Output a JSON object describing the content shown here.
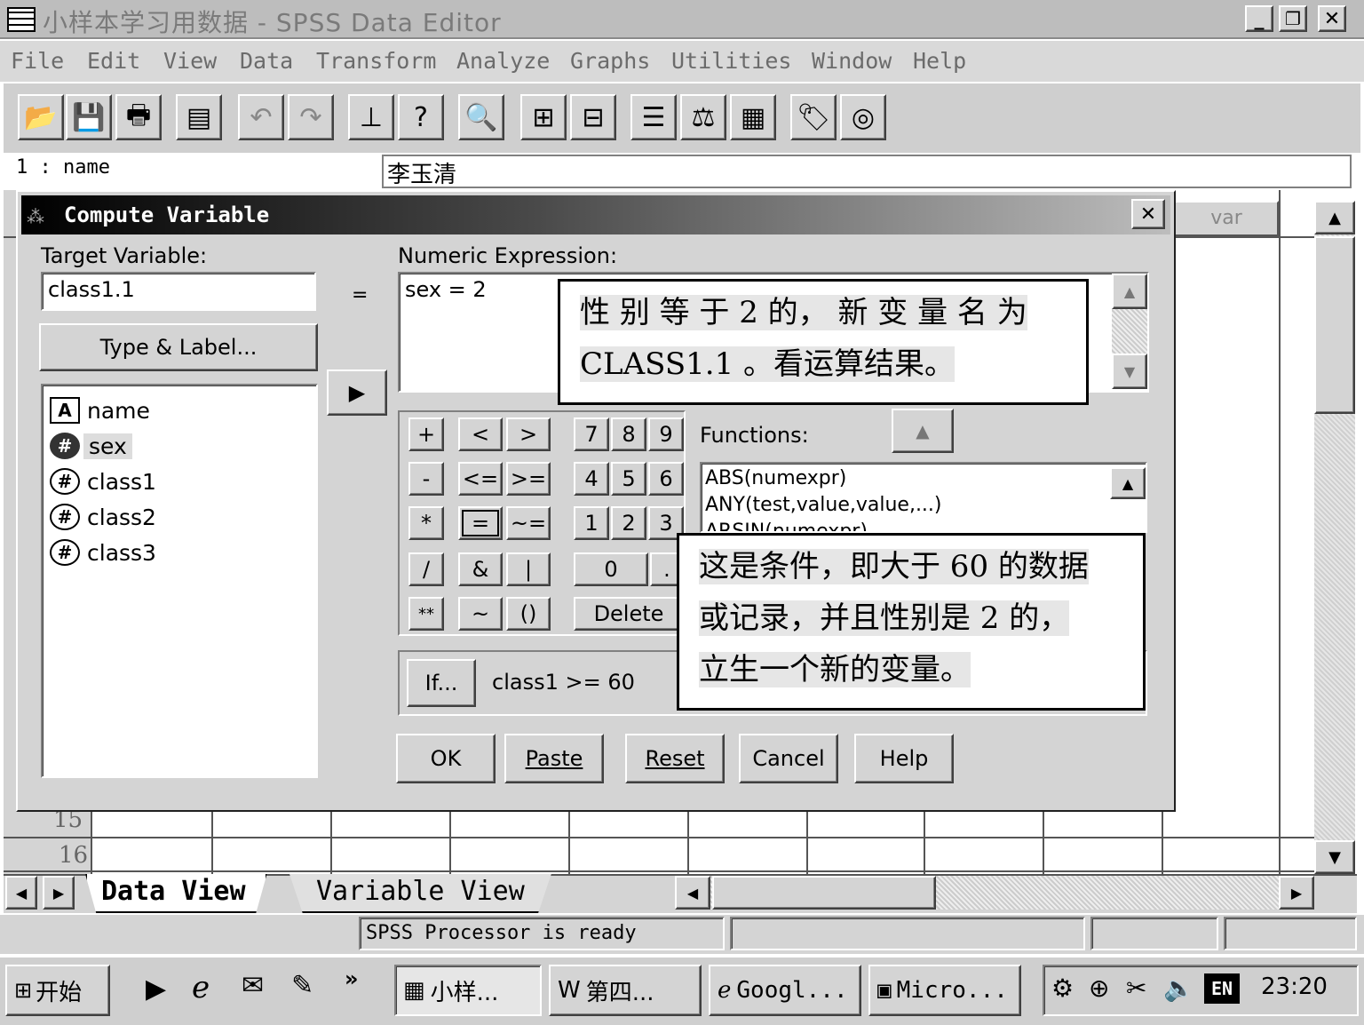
{
  "window": {
    "title": "小样本学习用数据 - SPSS Data Editor",
    "minimize": "_",
    "maximize": "❐",
    "close": "✕"
  },
  "menu": [
    "File",
    "Edit",
    "View",
    "Data",
    "Transform",
    "Analyze",
    "Graphs",
    "Utilities",
    "Window",
    "Help"
  ],
  "cell_editor": {
    "ref": "1  :  name",
    "value": "李玉清"
  },
  "grid": {
    "column_header": "var",
    "rows": [
      "15",
      "16"
    ]
  },
  "dialog": {
    "title": "Compute Variable",
    "close": "✕",
    "target_label": "Target Variable:",
    "target_value": "class1.1",
    "equals": "=",
    "type_label_button": "Type & Label...",
    "variables": [
      {
        "icon": "A",
        "name": "name"
      },
      {
        "icon": "#",
        "name": "sex"
      },
      {
        "icon": "#",
        "name": "class1"
      },
      {
        "icon": "#",
        "name": "class2"
      },
      {
        "icon": "#",
        "name": "class3"
      }
    ],
    "expression_label": "Numeric Expression:",
    "expression_value": "sex = 2",
    "functions_label": "Functions:",
    "functions": [
      "ABS(numexpr)",
      "ANY(test,value,value,...)",
      "ARSIN(numexpr)"
    ],
    "keypad": {
      "ops": [
        "+",
        "<",
        ">",
        "-",
        "<=",
        ">=",
        "*",
        "=",
        "~=",
        "/",
        "&",
        "|",
        "**",
        "~",
        "()"
      ],
      "digits": [
        "7",
        "8",
        "9",
        "4",
        "5",
        "6",
        "1",
        "2",
        "3",
        "0",
        "."
      ],
      "delete": "Delete"
    },
    "if_button": "If...",
    "if_condition": "class1 >= 60",
    "buttons": {
      "ok": "OK",
      "paste": "Paste",
      "reset": "Reset",
      "cancel": "Cancel",
      "help": "Help"
    }
  },
  "callouts": {
    "top": [
      "性 别 等 于  2  的， 新 变 量 名 为",
      "CLASS1.1 。看运算结果。"
    ],
    "bottom": [
      "这是条件，即大于 60 的数据",
      "或记录，并且性别是 2 的，",
      "立生一个新的变量。"
    ]
  },
  "tabs": {
    "data_view": "Data View",
    "variable_view": "Variable View"
  },
  "status": "SPSS Processor  is ready",
  "taskbar": {
    "start": "开始",
    "chevron": "»",
    "tasks": [
      "小样...",
      "第四...",
      "Googl...",
      "Micro..."
    ],
    "ime": "EN",
    "clock": "23:20"
  }
}
